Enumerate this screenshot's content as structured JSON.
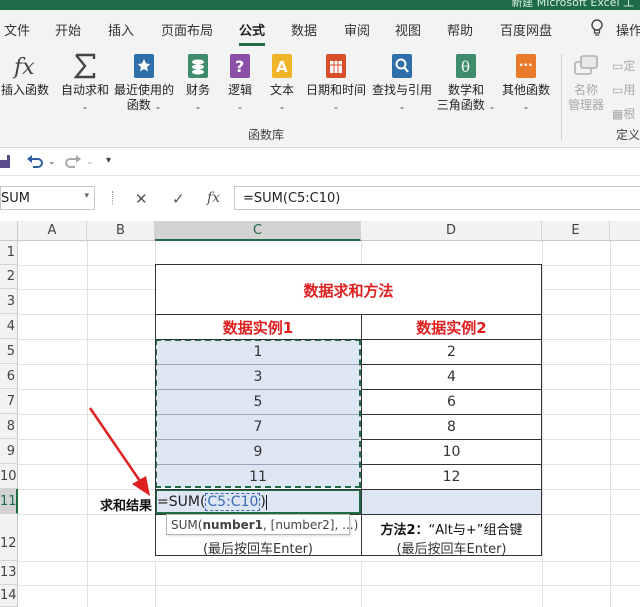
{
  "titlebar": {
    "text": "新建 Microsoft Excel 工"
  },
  "tabs": [
    "文件",
    "开始",
    "插入",
    "页面布局",
    "公式",
    "数据",
    "审阅",
    "视图",
    "帮助",
    "百度网盘",
    "操作"
  ],
  "active_tab": "公式",
  "ribbon": {
    "buttons": [
      {
        "label": "插入函数",
        "icon": "fx-icon"
      },
      {
        "label": "自动求和",
        "icon": "sigma-icon"
      },
      {
        "label": "最近使用的",
        "label2": "函数",
        "icon": "recent-functions-icon"
      },
      {
        "label": "财务",
        "icon": "finance-icon"
      },
      {
        "label": "逻辑",
        "icon": "logic-icon"
      },
      {
        "label": "文本",
        "icon": "text-function-icon"
      },
      {
        "label": "日期和时间",
        "icon": "date-time-icon"
      },
      {
        "label": "查找与引用",
        "icon": "lookup-reference-icon"
      },
      {
        "label": "数学和",
        "label2": "三角函数",
        "icon": "math-trig-icon"
      },
      {
        "label": "其他函数",
        "icon": "more-functions-icon"
      },
      {
        "label": "名称",
        "label2": "管理器",
        "icon": "name-manager-icon"
      }
    ],
    "right_items": [
      "定",
      "用",
      "根"
    ],
    "group_label": "函数库",
    "group_label2": "定义"
  },
  "formula_bar": {
    "name_box": "SUM",
    "cancel": "✕",
    "enter": "✓",
    "fx": "fx",
    "formula": "=SUM(C5:C10)"
  },
  "columns": [
    "A",
    "B",
    "C",
    "D",
    "E"
  ],
  "rows": [
    "1",
    "2",
    "3",
    "4",
    "5",
    "6",
    "7",
    "8",
    "9",
    "10",
    "11",
    "12",
    "13",
    "14"
  ],
  "sheet": {
    "title": "数据求和方法",
    "header1": "数据实例1",
    "header2": "数据实例2",
    "col1": [
      "1",
      "3",
      "5",
      "7",
      "9",
      "11"
    ],
    "col2": [
      "2",
      "4",
      "6",
      "8",
      "10",
      "12"
    ],
    "label_result": "求和结果",
    "editing_formula_prefix": "=SUM(",
    "editing_formula_ref": "C5:C10",
    "editing_formula_suffix": ")",
    "tooltip": {
      "fn": "SUM(",
      "arg1": "number1",
      "rest": ", [number2], ...)"
    },
    "c12_line2": "(最后按回车Enter)",
    "d12_line1_bold": "方法2：",
    "d12_line1_rest": "“Alt与+”组合键",
    "d12_line2": "(最后按回车Enter)"
  },
  "colors": {
    "accent": "#1e6b45",
    "red": "#e02020",
    "selection": "#dfe6f3"
  }
}
